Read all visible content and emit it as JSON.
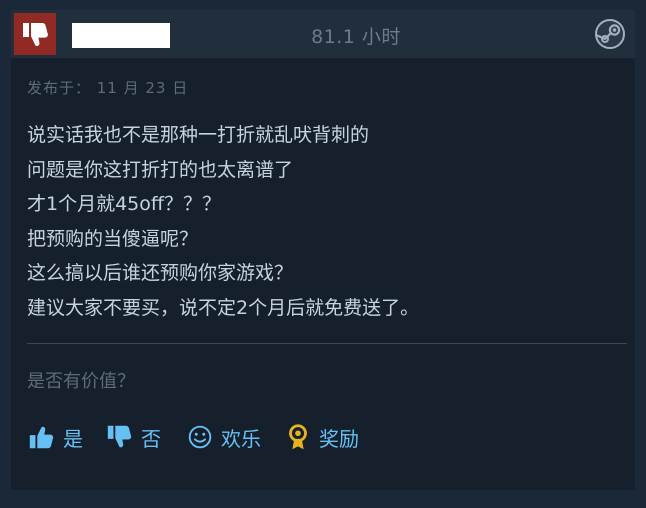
{
  "header": {
    "rating_icon": "thumbs-down-icon",
    "hours": "81.1 小时",
    "steam_icon": "steam-logo-icon"
  },
  "review": {
    "posted": "发布于： 11 月 23 日",
    "lines": [
      "说实话我也不是那种一打折就乱吠背刺的",
      "问题是你这打折打的也太离谱了",
      "才1个月就45off？？？",
      "把预购的当傻逼呢？",
      "这么搞以后谁还预购你家游戏？",
      "建议大家不要买，说不定2个月后就免费送了。"
    ]
  },
  "footer": {
    "helpful_question": "是否有价值？",
    "buttons": {
      "yes": "是",
      "no": "否",
      "funny": "欢乐",
      "award": "奖励"
    }
  },
  "colors": {
    "background": "#1b2838",
    "card": "#16202d",
    "header": "#212f3d",
    "thumb_bg": "#922a24",
    "accent": "#66c0f4"
  }
}
